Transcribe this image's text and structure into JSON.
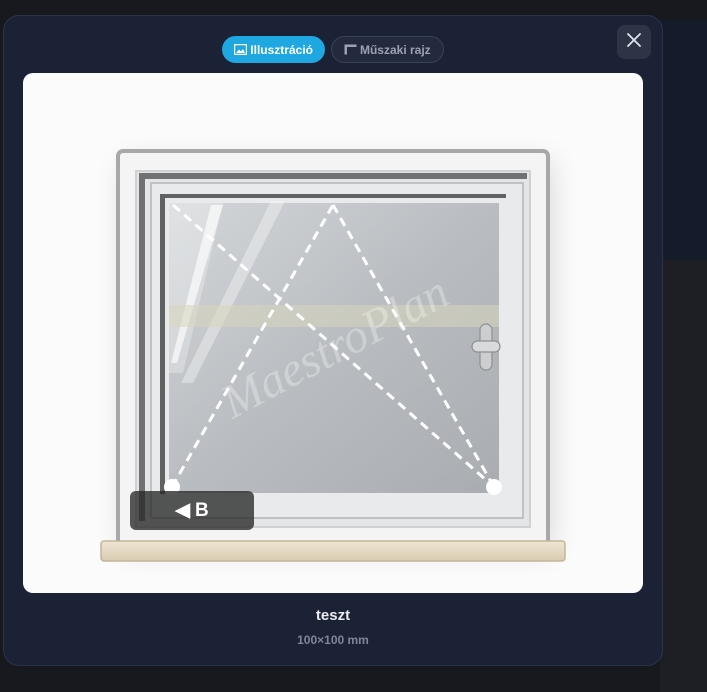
{
  "tabs": [
    {
      "label": "Illusztráció",
      "icon": "image-icon",
      "active": true
    },
    {
      "label": "Műszaki rajz",
      "icon": "blueprint-icon",
      "active": false
    }
  ],
  "close": {
    "icon": "close-icon"
  },
  "preview": {
    "watermark": "MaestroPlan",
    "opening_badge": {
      "arrow": "◀",
      "label": "B"
    }
  },
  "product": {
    "name": "teszt",
    "dimensions": "100×100 mm"
  },
  "colors": {
    "accent": "#1fa7e1",
    "modal_bg": "#1c2235"
  }
}
